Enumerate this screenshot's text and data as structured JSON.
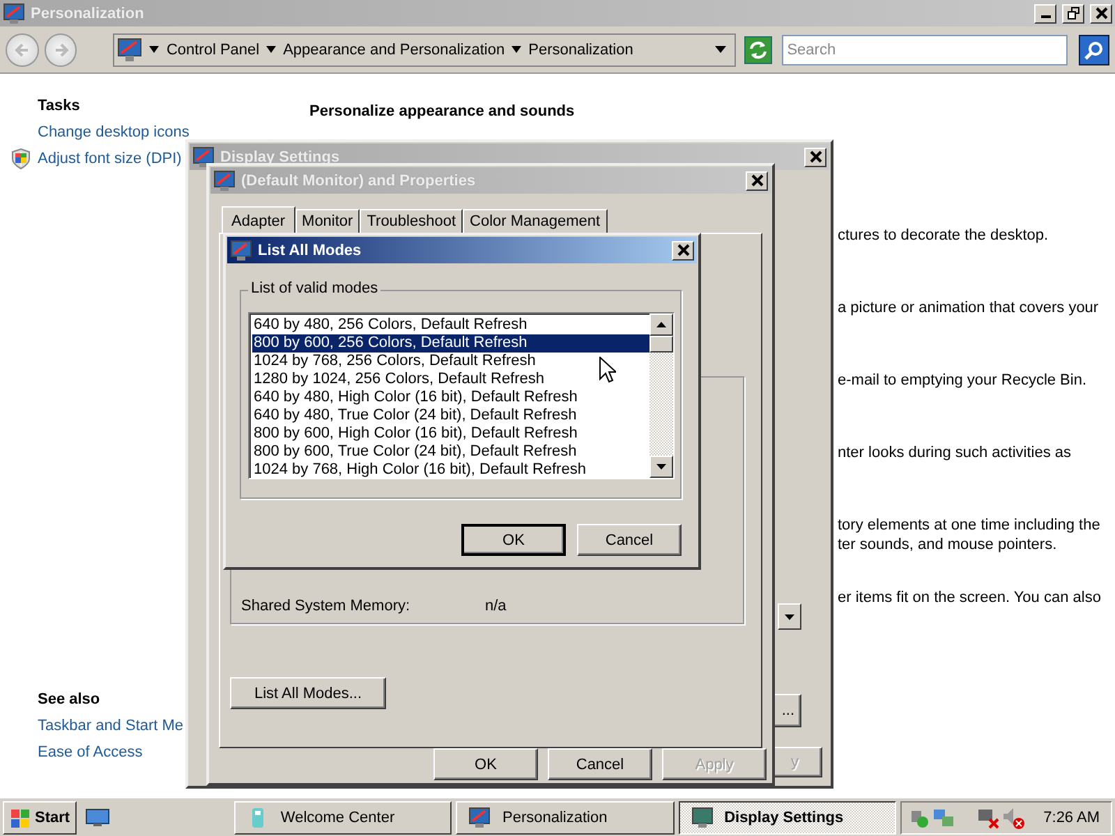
{
  "personalization_window": {
    "title": "Personalization",
    "active": false,
    "address": {
      "crumbs": [
        "Control Panel",
        "Appearance and Personalization",
        "Personalization"
      ]
    },
    "search": {
      "placeholder": "Search"
    },
    "sidebar": {
      "tasks_heading": "Tasks",
      "tasks": [
        {
          "label": "Change desktop icons",
          "shield": false
        },
        {
          "label": "Adjust font size (DPI)",
          "shield": true
        }
      ],
      "see_also_heading": "See also",
      "see_also": [
        "Taskbar and Start Me",
        "Ease of Access"
      ]
    },
    "heading": "Personalize appearance and sounds",
    "paragraphs": [
      [
        "ctures to decorate the desktop."
      ],
      [
        "a picture or animation that covers your"
      ],
      [
        "e-mail to emptying your Recycle Bin."
      ],
      [
        "nter looks during such activities as"
      ],
      [
        "tory elements at one time including the",
        "ter sounds, and mouse pointers."
      ],
      [
        "er items fit on the screen. You can also"
      ]
    ]
  },
  "display_settings_window": {
    "title": "Display Settings",
    "active": false,
    "more_button": "...",
    "apply_button": {
      "label": "y",
      "disabled": true
    }
  },
  "properties_dialog": {
    "title": "(Default Monitor) and  Properties",
    "active": false,
    "tabs": [
      {
        "label": "Adapter",
        "selected": true
      },
      {
        "label": "Monitor",
        "selected": false
      },
      {
        "label": "Troubleshoot",
        "selected": false
      },
      {
        "label": "Color Management",
        "selected": false
      }
    ],
    "info": [
      {
        "label": "Shared System Memory:",
        "value": "n/a"
      }
    ],
    "list_all_modes_button": "List All Modes...",
    "buttons": [
      {
        "label": "OK",
        "disabled": false
      },
      {
        "label": "Cancel",
        "disabled": false
      },
      {
        "label": "Apply",
        "disabled": true
      }
    ]
  },
  "list_modes_dialog": {
    "title": "List All Modes",
    "active": true,
    "group_label": "List of valid modes",
    "modes": [
      {
        "label": "640 by 480, 256 Colors, Default Refresh",
        "selected": false
      },
      {
        "label": "800 by 600, 256 Colors, Default Refresh",
        "selected": true
      },
      {
        "label": "1024 by 768, 256 Colors, Default Refresh",
        "selected": false
      },
      {
        "label": "1280 by 1024, 256 Colors, Default Refresh",
        "selected": false
      },
      {
        "label": "640 by 480, High Color (16 bit), Default Refresh",
        "selected": false
      },
      {
        "label": "640 by 480, True Color (24 bit), Default Refresh",
        "selected": false
      },
      {
        "label": "800 by 600, High Color (16 bit), Default Refresh",
        "selected": false
      },
      {
        "label": "800 by 600, True Color (24 bit), Default Refresh",
        "selected": false
      },
      {
        "label": "1024 by 768, High Color (16 bit), Default Refresh",
        "selected": false
      }
    ],
    "buttons": [
      {
        "label": "OK",
        "default": true
      },
      {
        "label": "Cancel",
        "default": false
      }
    ]
  },
  "taskbar": {
    "start": "Start",
    "tasks": [
      {
        "label": "Welcome Center",
        "selected": false
      },
      {
        "label": "Personalization",
        "selected": false
      },
      {
        "label": "Display Settings",
        "selected": true
      }
    ],
    "clock": "7:26 AM"
  }
}
